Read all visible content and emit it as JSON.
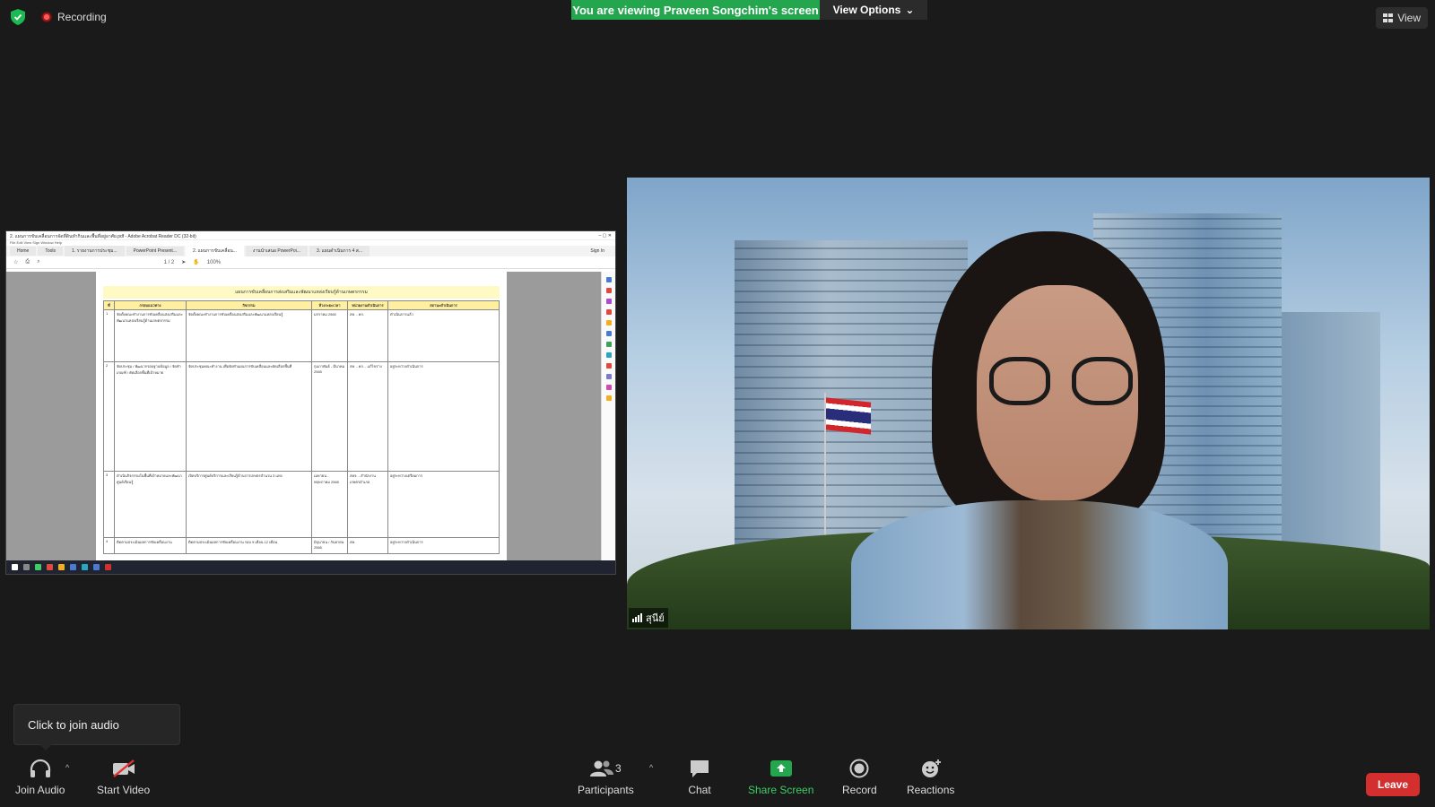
{
  "top": {
    "recording_label": "Recording",
    "viewing_banner": "You are viewing Praveen Songchim's screen",
    "view_options_label": "View Options",
    "view_label": "View"
  },
  "shared_screen": {
    "window_title": "2. แผนการขับเคลื่อนการจัดที่ดินทำกินและพื้นที่อยู่อาศัย.pdf - Adobe Acrobat Reader DC (32-bit)",
    "menu": "File  Edit  View  Sign  Window  Help",
    "tabs": [
      "Home",
      "Tools",
      "1. รายงานการประชุม...",
      "PowerPoint Present...",
      "2. แผนการขับเคลื่อน...",
      "งานนำเสนอ PowerPoi...",
      "3. แผนดำเนินการ 4 ส..."
    ],
    "sign_in": "Sign In",
    "page_indicator": "1 / 2",
    "zoom": "100%",
    "doc_title": "แผนการขับเคลื่อนการส่งเสริมและพัฒนาแหล่งเรียนรู้ด้านเกษตรกรรม",
    "table_headers": [
      "ที่",
      "กรอบแนวทาง",
      "กิจกรรม",
      "ห้วงระยะเวลา",
      "หน่วยงานดำเนินการ",
      "สถานะดำเนินการ"
    ],
    "rows": [
      {
        "no": "1",
        "frame": "จัดตั้งคณะทำงานการขับเคลื่อนส่งเสริมและพัฒนาแหล่งเรียนรู้ด้านเกษตรกรรม",
        "activity": "จัดตั้งคณะทำงานการขับเคลื่อนส่งเสริมและพัฒนาแหล่งเรียนรู้",
        "period": "มกราคม 2565",
        "agency": "สค. - คก.",
        "status": "ดำเนินการแล้ว"
      },
      {
        "no": "2",
        "frame": "จัดประชุม / พัฒนากรอบฐานข้อมูล / จัดทำเกณฑ์ / คัดเลือกพื้นที่เป้าหมาย",
        "activity": "จัดประชุมคณะทำงาน เพื่อจัดทำแผนการขับเคลื่อนและคัดเลือกพื้นที่",
        "period": "กุมภาพันธ์ - มีนาคม 2565",
        "agency": "สค. - คก. - แก้ไขร่าง",
        "status": "อยู่ระหว่างดำเนินการ"
      },
      {
        "no": "3",
        "frame": "ดำเนินกิจกรรมในพื้นที่เป้าหมายและพัฒนาศูนย์เรียนรู้",
        "activity": "เปิดบริการศูนย์บริการและเรียนรู้ด้านการเกษตรจำนวน 3 แห่ง",
        "period": "เมษายน - พฤษภาคม 2565",
        "agency": "สคจ. - สำนักงานเกษตรอำเภอ",
        "status": "อยู่ระหว่างเตรียมการ"
      },
      {
        "no": "4",
        "frame": "ติดตามประเมินผลการขับเคลื่อนงาน",
        "activity": "ติดตามประเมินผลการขับเคลื่อนงาน รอบ 9 เดือน 12 เดือน",
        "period": "มิถุนายน / กันยายน 2565",
        "agency": "สค.",
        "status": "อยู่ระหว่างดำเนินการ"
      }
    ]
  },
  "video_tile": {
    "participant_name": "สุนีย์"
  },
  "tooltip": {
    "text": "Click to join audio"
  },
  "toolbar": {
    "join_audio": "Join Audio",
    "start_video": "Start Video",
    "participants": "Participants",
    "participants_count": "3",
    "chat": "Chat",
    "share_screen": "Share Screen",
    "record": "Record",
    "reactions": "Reactions",
    "leave": "Leave"
  },
  "colors": {
    "banner_green": "#23a64e",
    "share_green": "#3ccf64",
    "leave_red": "#d32f2f",
    "background": "#1a1a1a"
  }
}
